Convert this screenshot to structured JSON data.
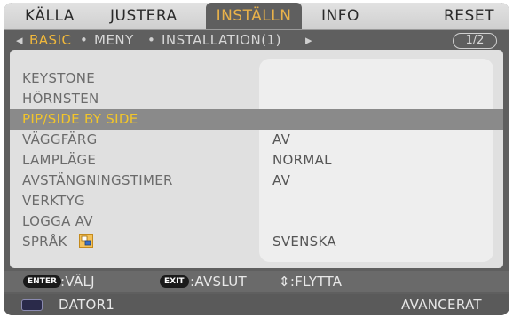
{
  "tabs": [
    {
      "label": "KÄLLA"
    },
    {
      "label": "JUSTERA"
    },
    {
      "label": "INSTÄLLN"
    },
    {
      "label": "INFO"
    },
    {
      "label": "RESET"
    }
  ],
  "active_tab": "INSTÄLLN",
  "subtabs": {
    "left_arrow": "◂",
    "basic": "BASIC",
    "meny": "MENY",
    "installation": "INSTALLATION(1)",
    "right_arrow": "▸",
    "bullet": "•",
    "page": "1/2"
  },
  "rows": [
    {
      "label": "KEYSTONE",
      "value": ""
    },
    {
      "label": "HÖRNSTEN",
      "value": ""
    },
    {
      "label": "PIP/SIDE BY SIDE",
      "value": ""
    },
    {
      "label": "VÄGGFÄRG",
      "value": "AV"
    },
    {
      "label": "LAMPLÄGE",
      "value": "NORMAL"
    },
    {
      "label": "AVSTÄNGNINGSTIMER",
      "value": "AV"
    },
    {
      "label": "VERKTYG",
      "value": ""
    },
    {
      "label": "LOGGA AV",
      "value": ""
    },
    {
      "label": "SPRÅK",
      "value": "SVENSKA"
    }
  ],
  "selected_row": "PIP/SIDE BY SIDE",
  "footer": {
    "enter_key": "ENTER",
    "enter_label": ":VÄLJ",
    "exit_key": "EXIT",
    "exit_label": ":AVSLUT",
    "move_label": "⇕:FLYTTA",
    "source": "DATOR1",
    "mode": "AVANCERAT"
  },
  "icons": {
    "source": "computer-source-icon",
    "language": "language-icon"
  },
  "colors": {
    "active_tab_text": "#e9b24a",
    "selected_label": "#f2c52a",
    "frame": "#5f5f5f"
  }
}
